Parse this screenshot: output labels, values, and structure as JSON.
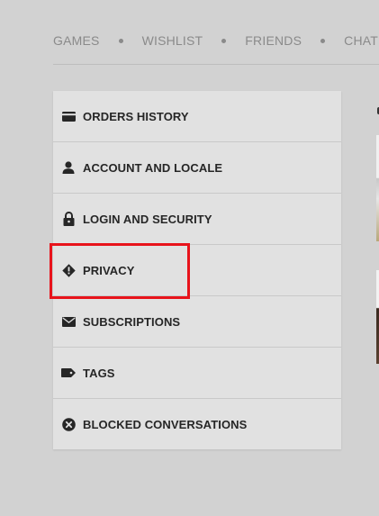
{
  "nav": {
    "items": [
      {
        "label": "GAMES"
      },
      {
        "label": "WISHLIST"
      },
      {
        "label": "FRIENDS"
      },
      {
        "label": "CHAT"
      }
    ]
  },
  "menu": {
    "items": [
      {
        "label": "ORDERS HISTORY",
        "icon": "card-icon"
      },
      {
        "label": "ACCOUNT AND LOCALE",
        "icon": "user-icon"
      },
      {
        "label": "LOGIN AND SECURITY",
        "icon": "lock-icon"
      },
      {
        "label": "PRIVACY",
        "icon": "privacy-shield-icon",
        "highlighted": true
      },
      {
        "label": "SUBSCRIPTIONS",
        "icon": "envelope-icon"
      },
      {
        "label": "TAGS",
        "icon": "tag-icon"
      },
      {
        "label": "BLOCKED CONVERSATIONS",
        "icon": "blocked-icon"
      }
    ]
  },
  "colors": {
    "background": "#d2d2d2",
    "menu_bg": "#e1e1e1",
    "highlight": "#e8131b",
    "nav_text": "#8a8a8a",
    "menu_text": "#262626"
  }
}
